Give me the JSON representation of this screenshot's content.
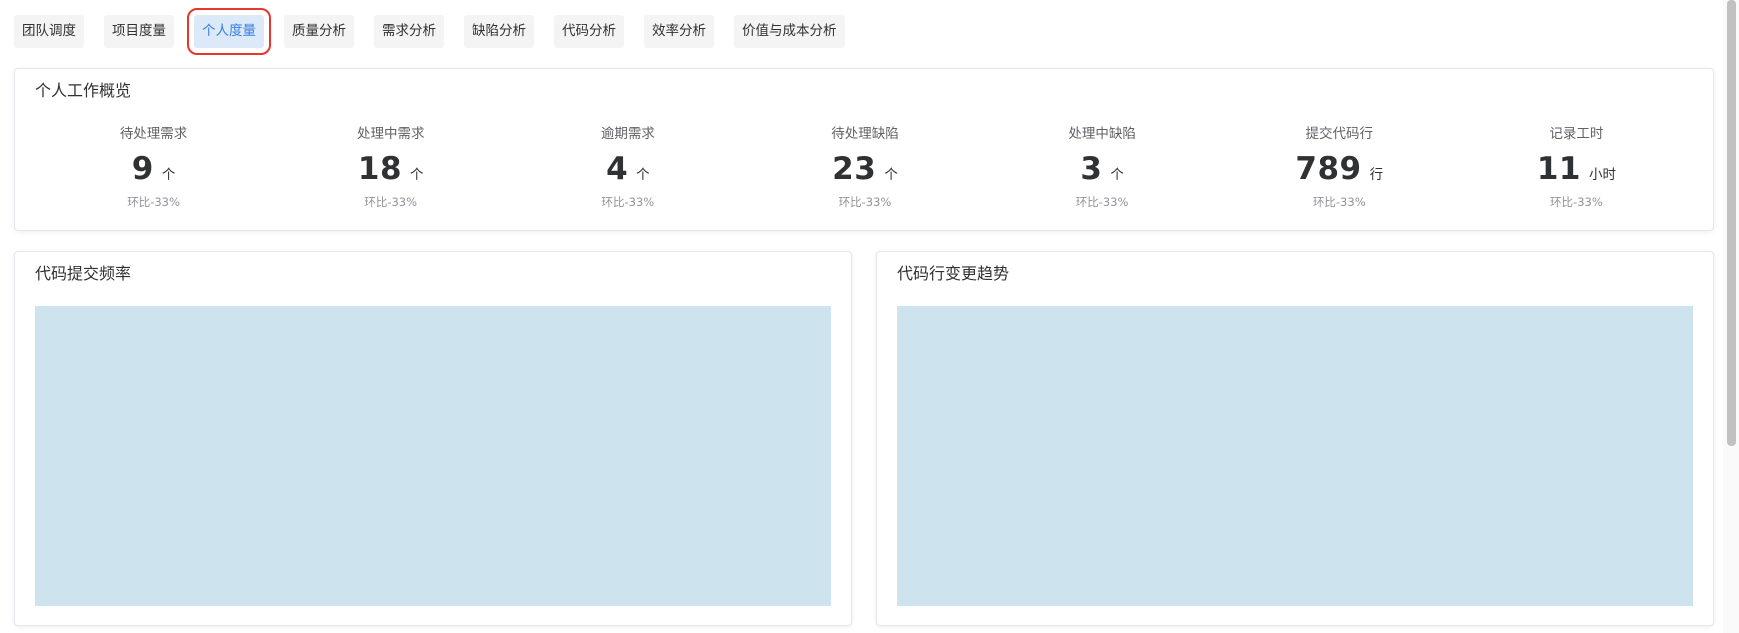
{
  "tabs": [
    {
      "label": "团队调度",
      "active": false
    },
    {
      "label": "项目度量",
      "active": false
    },
    {
      "label": "个人度量",
      "active": true
    },
    {
      "label": "质量分析",
      "active": false
    },
    {
      "label": "需求分析",
      "active": false
    },
    {
      "label": "缺陷分析",
      "active": false
    },
    {
      "label": "代码分析",
      "active": false
    },
    {
      "label": "效率分析",
      "active": false
    },
    {
      "label": "价值与成本分析",
      "active": false
    }
  ],
  "overview": {
    "title": "个人工作概览",
    "metrics": [
      {
        "label": "待处理需求",
        "value": "9",
        "unit": "个",
        "ratio": "环比-33%"
      },
      {
        "label": "处理中需求",
        "value": "18",
        "unit": "个",
        "ratio": "环比-33%"
      },
      {
        "label": "逾期需求",
        "value": "4",
        "unit": "个",
        "ratio": "环比-33%"
      },
      {
        "label": "待处理缺陷",
        "value": "23",
        "unit": "个",
        "ratio": "环比-33%"
      },
      {
        "label": "处理中缺陷",
        "value": "3",
        "unit": "个",
        "ratio": "环比-33%"
      },
      {
        "label": "提交代码行",
        "value": "789",
        "unit": "行",
        "ratio": "环比-33%"
      },
      {
        "label": "记录工时",
        "value": "11",
        "unit": "小时",
        "ratio": "环比-33%"
      }
    ]
  },
  "charts": {
    "left_title": "代码提交频率",
    "right_title": "代码行变更趋势"
  },
  "colors": {
    "active_tab_bg": "#dbe9f9",
    "active_tab_text": "#3a7ee0",
    "highlight_outline": "#e8362d",
    "chart_placeholder": "#cde4ee"
  }
}
